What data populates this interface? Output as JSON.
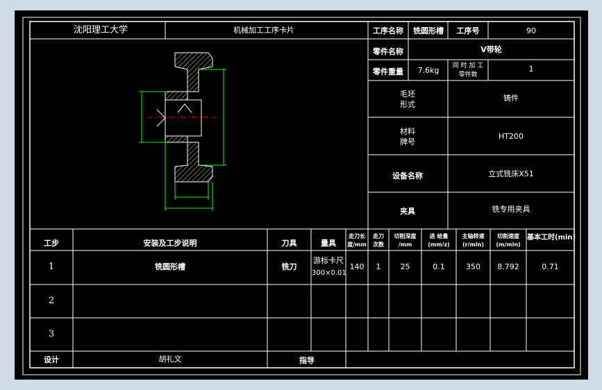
{
  "header": {
    "university": "沈阳理工大学",
    "card_title": "机械加工工序卡片",
    "process_name_label": "工序名称",
    "process_name_value": "铣圆形槽",
    "process_no_label": "工序号",
    "process_no_value": "90",
    "part_name_label": "零件名称",
    "part_name_value": "V带轮",
    "part_weight_label": "零件重量",
    "part_weight_value": "7.6kg",
    "simul_label_1": "同 时 加 工",
    "simul_label_2": "零件数",
    "simul_value": "1",
    "blank_label_1": "毛坯",
    "blank_label_2": "形式",
    "blank_value": "铸件",
    "material_label_1": "材料",
    "material_label_2": "牌号",
    "material_value": "HT200",
    "equipment_label": "设备名称",
    "equipment_value": "立式铣床X51",
    "fixture_label": "夹具",
    "fixture_value": "铣专用夹具"
  },
  "table": {
    "headers": {
      "step": "工步",
      "desc": "安装及工步说明",
      "tool": "刀具",
      "gauge": "量具",
      "feed_len_1": "走刀长",
      "feed_len_2": "度/mm",
      "passes_1": "走刀",
      "passes_2": "次数",
      "depth_1": "切削深度",
      "depth_2": "/mm",
      "feed_1": "进 给量",
      "feed_2": "(mm/z)",
      "speed_1": "主轴转速",
      "speed_2": "(r/min)",
      "cut_speed_1": "切削速度",
      "cut_speed_2": "(m/min)",
      "time": "基本工时(min)"
    },
    "rows": [
      {
        "step": "1",
        "desc": "铣圆形槽",
        "tool": "铣刀",
        "gauge_1": "游标卡尺",
        "gauge_2": "300×0.01",
        "feed_len": "140",
        "passes": "1",
        "depth": "25",
        "feed": "0.1",
        "speed": "350",
        "cut_speed": "8.792",
        "time": "0.71"
      },
      {
        "step": "2"
      },
      {
        "step": "3"
      }
    ],
    "design_label": "设计",
    "designer": "胡礼文",
    "guide_label": "指导"
  },
  "colors": {
    "background": "#cfdbe6",
    "paper": "#000000",
    "lines": "#ffffff",
    "dimension": "#00ff00",
    "centerline": "#ff0000",
    "hatch": "#ffffff"
  }
}
